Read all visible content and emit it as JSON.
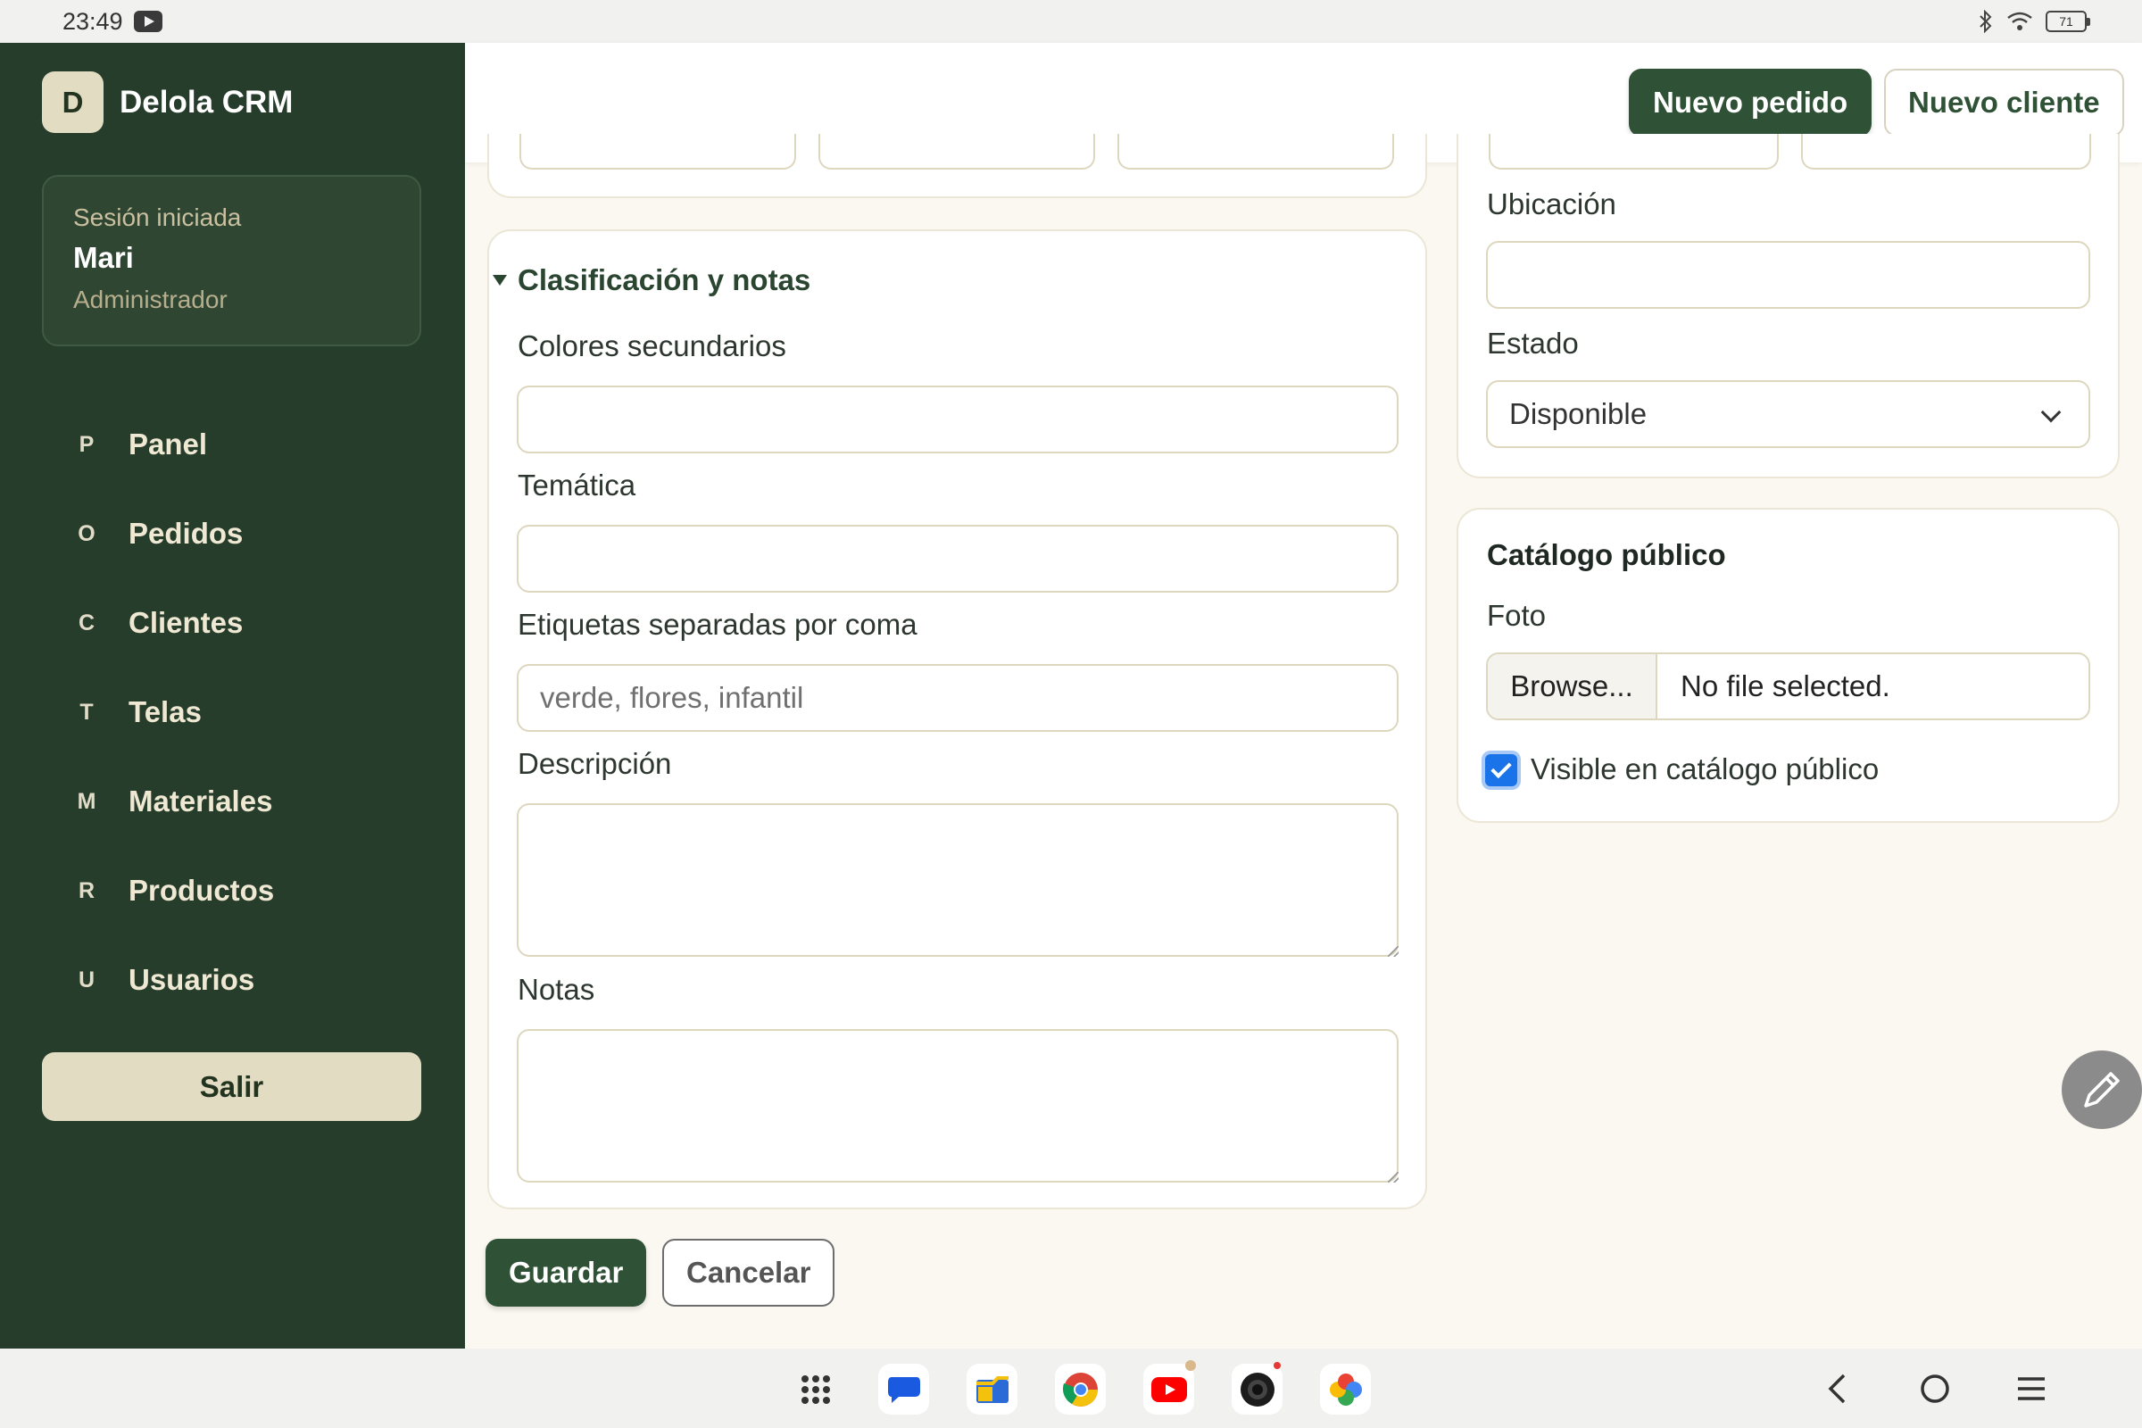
{
  "status_bar": {
    "time": "23:49",
    "battery": "71"
  },
  "sidebar": {
    "logo_letter": "D",
    "brand": "Delola CRM",
    "session": {
      "label": "Sesión iniciada",
      "user": "Mari",
      "role": "Administrador"
    },
    "items": [
      {
        "key": "P",
        "label": "Panel"
      },
      {
        "key": "O",
        "label": "Pedidos"
      },
      {
        "key": "C",
        "label": "Clientes"
      },
      {
        "key": "T",
        "label": "Telas"
      },
      {
        "key": "M",
        "label": "Materiales"
      },
      {
        "key": "R",
        "label": "Productos"
      },
      {
        "key": "U",
        "label": "Usuarios"
      }
    ],
    "logout_label": "Salir"
  },
  "header": {
    "new_order": "Nuevo pedido",
    "new_client": "Nuevo cliente"
  },
  "classification": {
    "title": "Clasificación y notas",
    "secondary_colors_label": "Colores secundarios",
    "secondary_colors_value": "",
    "theme_label": "Temática",
    "theme_value": "",
    "tags_label": "Etiquetas separadas por coma",
    "tags_placeholder": "verde, flores, infantil",
    "description_label": "Descripción",
    "description_value": "",
    "notes_label": "Notas",
    "notes_value": ""
  },
  "inventory": {
    "location_label": "Ubicación",
    "location_value": "",
    "status_label": "Estado",
    "status_value": "Disponible"
  },
  "catalog": {
    "title": "Catálogo público",
    "photo_label": "Foto",
    "browse_label": "Browse...",
    "file_status": "No file selected.",
    "visible_label": "Visible en catálogo público",
    "visible_checked": true
  },
  "actions": {
    "save": "Guardar",
    "cancel": "Cancelar"
  },
  "dock_icons": [
    "app-drawer-icon",
    "messages-icon",
    "files-icon",
    "chrome-icon",
    "youtube-icon",
    "camera-icon",
    "photos-icon"
  ],
  "colors": {
    "sidebar": "#273d2c",
    "primary": "#2f5236",
    "accent_cream": "#e2dcc3",
    "checkbox": "#1a73e8"
  }
}
